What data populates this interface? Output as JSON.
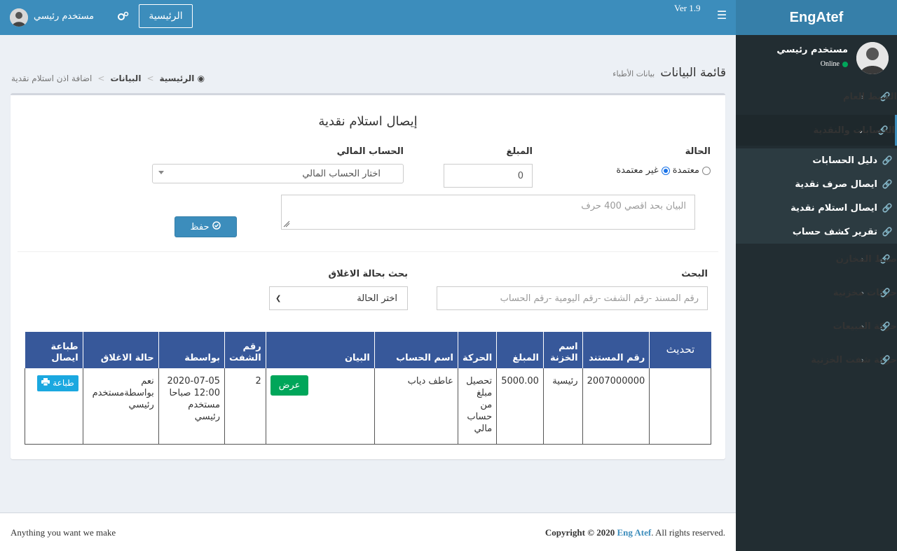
{
  "header": {
    "logo": "EngAtef",
    "version": "Ver 1.9",
    "home_label": "الرئيسية",
    "user_name": "مستخدم رئيسي"
  },
  "sidebar": {
    "user_name": "مستخدم رئيسي",
    "status": "Online",
    "items": [
      {
        "label": "الضبط العام"
      },
      {
        "label": "الحسابات والنقدية"
      },
      {
        "label": "ضبط المخازن"
      },
      {
        "label": "حركات مخزنية"
      },
      {
        "label": "حركة المبيعات"
      },
      {
        "label": "حركة شفت الخزنية"
      }
    ],
    "subitems": [
      {
        "label": "دليل الحسابات"
      },
      {
        "label": "ايصال صرف نقدية"
      },
      {
        "label": "ايصال استلام نقدية"
      },
      {
        "label": "تقرير كشف حساب"
      }
    ]
  },
  "page": {
    "title": "قائمة البيانات",
    "subtitle": "بيانات الأطباء",
    "breadcrumb": {
      "home": "الرئيسية",
      "data": "البيانات",
      "current": "اضافة اذن استلام نقدية"
    }
  },
  "form": {
    "title": "إيصال استلام نقدية",
    "status_label": "الحالة",
    "status_approved": "معتمدة",
    "status_unapproved": "غير معتمدة",
    "amount_label": "المبلغ",
    "amount_value": "0",
    "account_label": "الحساب المالي",
    "account_placeholder": "اختار الحساب المالي",
    "notes_placeholder": "البيان بحد اقصي 400 حرف",
    "save_label": "حفظ"
  },
  "search": {
    "label": "البحث",
    "placeholder": "رقم المسند -رقم الشفت   -رقم اليومية   -رقم   الحساب",
    "closing_label": "بحث بحالة الاغلاق",
    "closing_value": "اختر الحالة"
  },
  "table": {
    "headers": {
      "refresh": "تحديث",
      "doc_no": "رقم المستند",
      "treasury": "اسم الخزنة",
      "amount": "المبلغ",
      "movement": "الحركة",
      "account": "اسم الحساب",
      "statement": "البيان",
      "shift": "رقم الشفت",
      "by": "بواسطة",
      "closing": "حالة الاغلاق",
      "print": "طباعة ايصال"
    },
    "rows": [
      {
        "doc_no": "2007000000",
        "treasury": "رئيسية",
        "amount": "5000.00",
        "movement": "تحصيل مبلغ من حساب مالي",
        "account": "عاطف دياب",
        "view": "عرض",
        "shift": "2",
        "by": "2020-07-05 12:00 صباحا مستخدم رئيسي",
        "closing": "نعم بواسطةمستخدم رئيسي",
        "print": "طباعة"
      }
    ]
  },
  "footer": {
    "left": "Anything you want we make",
    "copyright_prefix": "Copyright © 2020",
    "brand": "Eng Atef",
    "copyright_suffix": ". All rights reserved."
  },
  "colors": {
    "header": "#3c8dbc",
    "logo_bg": "#367fa9",
    "sidebar": "#222d32",
    "table_header": "#37589a",
    "view_button": "#00a65a",
    "print_button": "#1ba8e0"
  }
}
